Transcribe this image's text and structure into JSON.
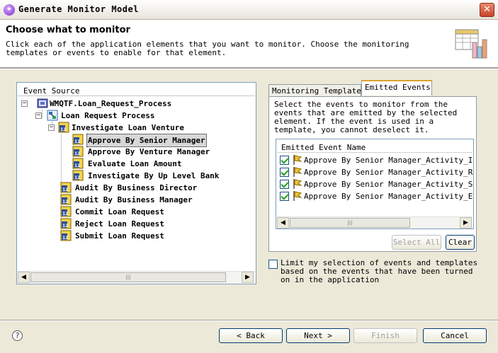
{
  "window": {
    "title": "Generate Monitor Model"
  },
  "header": {
    "title": "Choose what to monitor",
    "description": "Click each of the application elements that you want to monitor. Choose the monitoring templates or events to enable for that element."
  },
  "event_source": {
    "title": "Event Source",
    "items": [
      {
        "label": "WMQTF.Loan_Request_Process"
      },
      {
        "label": "Loan Request Process"
      },
      {
        "label": "Investigate Loan Venture"
      },
      {
        "label": "Approve By Senior Manager"
      },
      {
        "label": "Approve By Venture Manager"
      },
      {
        "label": "Evaluate Loan Amount"
      },
      {
        "label": "Investigate By Up Level Bank"
      },
      {
        "label": "Audit By Business Director"
      },
      {
        "label": "Audit By Business Manager"
      },
      {
        "label": "Commit Loan Request"
      },
      {
        "label": "Reject Loan Request"
      },
      {
        "label": "Submit Loan Request"
      }
    ]
  },
  "tabs": [
    {
      "label": "Monitoring Templates"
    },
    {
      "label": "Emitted Events"
    }
  ],
  "emitted_events": {
    "description": "Select the events to monitor from the events that are emitted by the selected element. If the event is used in a template, you cannot deselect it.",
    "column_header": "Emitted Event Name",
    "rows": [
      {
        "name": "Approve By Senior Manager_Activity_Implementation"
      },
      {
        "name": "Approve By Senior Manager_Activity_Ready"
      },
      {
        "name": "Approve By Senior Manager_Activity_Started"
      },
      {
        "name": "Approve By Senior Manager_Activity_Ended"
      }
    ],
    "select_all_label": "Select All",
    "clear_label": "Clear"
  },
  "limit_option": {
    "label": "Limit my selection of events and templates based on the events that have been turned on in the application"
  },
  "footer": {
    "help": "?",
    "back_label": "< Back",
    "next_label": "Next >",
    "finish_label": "Finish",
    "cancel_label": "Cancel"
  }
}
